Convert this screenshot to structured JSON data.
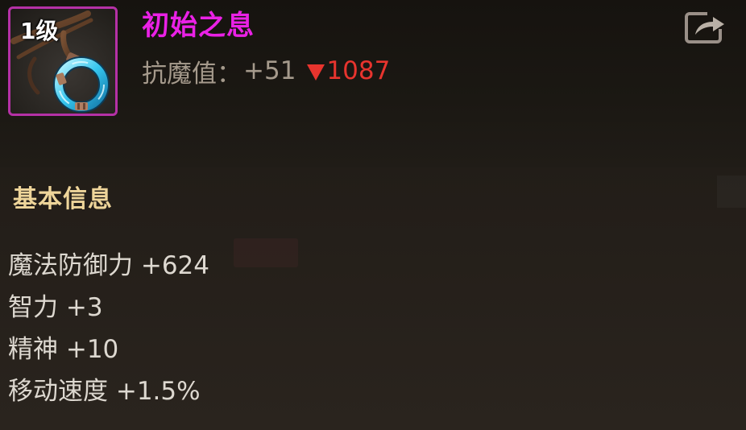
{
  "item": {
    "level": "1级",
    "name": "初始之息",
    "icon": "necklace-icon",
    "name_color": "#ea21e6",
    "frame_color": "#b531a6"
  },
  "compare": {
    "label": "抗魔值：",
    "value": "+51",
    "diff": "1087",
    "direction": "down",
    "diff_color": "#e8342e"
  },
  "share_button": {
    "icon": "share-icon"
  },
  "basic_info": {
    "title": "基本信息",
    "title_color": "#eed59a",
    "attributes": [
      "魔法防御力 +624",
      "智力 +3",
      "精神 +10",
      "移动速度 +1.5%"
    ]
  }
}
